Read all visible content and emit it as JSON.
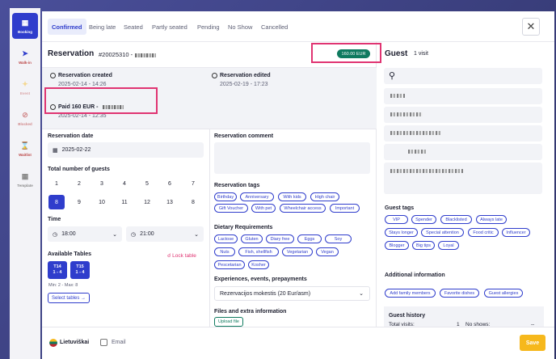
{
  "sidebar": {
    "items": [
      {
        "label": "Booking",
        "icon": "booking-icon"
      },
      {
        "label": "Walk-in",
        "icon": "walk-in-icon"
      },
      {
        "label": "Event",
        "icon": "event-icon"
      },
      {
        "label": "Blocked",
        "icon": "blocked-icon"
      },
      {
        "label": "Waitlist",
        "icon": "waitlist-icon"
      },
      {
        "label": "Template",
        "icon": "template-icon"
      }
    ]
  },
  "tabs": [
    "Confirmed",
    "Being late",
    "Seated",
    "Partly seated",
    "Pending",
    "No Show",
    "Cancelled"
  ],
  "reservation": {
    "title": "Reservation",
    "id": "#20025310 -",
    "price_badge": "160.00 EUR",
    "created_label": "Reservation created",
    "created_value": "2025-02-14 - 14:26",
    "edited_label": "Reservation edited",
    "edited_value": "2025-02-19 - 17:23",
    "paid_label": "Paid 160 EUR -",
    "paid_value": "2025-02-14 - 12:35"
  },
  "form": {
    "date_label": "Reservation date",
    "date_value": "2025-02-22",
    "guests_label": "Total number of guests",
    "guest_numbers": [
      "1",
      "2",
      "3",
      "4",
      "5",
      "6",
      "7",
      "8",
      "9",
      "10",
      "11",
      "12",
      "13",
      "8"
    ],
    "selected_guests": "8",
    "time_label": "Time",
    "time_from": "18:00",
    "time_to": "21:00",
    "tables_label": "Available Tables",
    "lock_table": "Lock table",
    "tables": [
      {
        "name": "T14",
        "range": "1 - 4"
      },
      {
        "name": "T15",
        "range": "1 - 4"
      }
    ],
    "min_max": "Min: 2 - Max: 8",
    "select_tables": "Select tables →"
  },
  "right_col": {
    "comment_label": "Reservation comment",
    "tags_label": "Reservation tags",
    "tags": [
      "Birthday",
      "Anniversary",
      "With kids",
      "High chair",
      "Gift Voucher",
      "With pet",
      "Wheelchair access",
      "Important"
    ],
    "dietary_label": "Dietary Requirements",
    "dietary": [
      "Lactose",
      "Gluten",
      "Diary free",
      "Eggs",
      "Soy",
      "Nuts",
      "Fish, shellfish",
      "Vegetarian",
      "Vegan",
      "Pescetarian",
      "Kosher"
    ],
    "experiences_label": "Experiences, events, prepayments",
    "experience_value": "Rezervacijos mokestis (20 Eur/asm)",
    "files_label": "Files and extra information",
    "upload": "Upload file"
  },
  "guest": {
    "title": "Guest",
    "visits": "1 visit",
    "tags_label": "Guest tags",
    "tags": [
      "VIP",
      "Spender",
      "Blacklisted",
      "Always late",
      "Stays longer",
      "Special attention",
      "Food critic",
      "Influencer",
      "Blogger",
      "Big tips",
      "Loyal"
    ],
    "additional_label": "Additional information",
    "additional": [
      "Add family members",
      "Favorite dishes",
      "Guest allergies"
    ],
    "history_label": "Guest history",
    "total_visits_label": "Total visits:",
    "total_visits": "1",
    "no_shows_label": "No shows:",
    "no_shows": "--"
  },
  "footer": {
    "language": "Lietuviškai",
    "email_label": "Email",
    "save": "Save"
  },
  "colors": {
    "accent": "#2f3dcc",
    "highlight": "#e03472",
    "badge": "#0f7a5f",
    "save": "#f6b81c"
  }
}
